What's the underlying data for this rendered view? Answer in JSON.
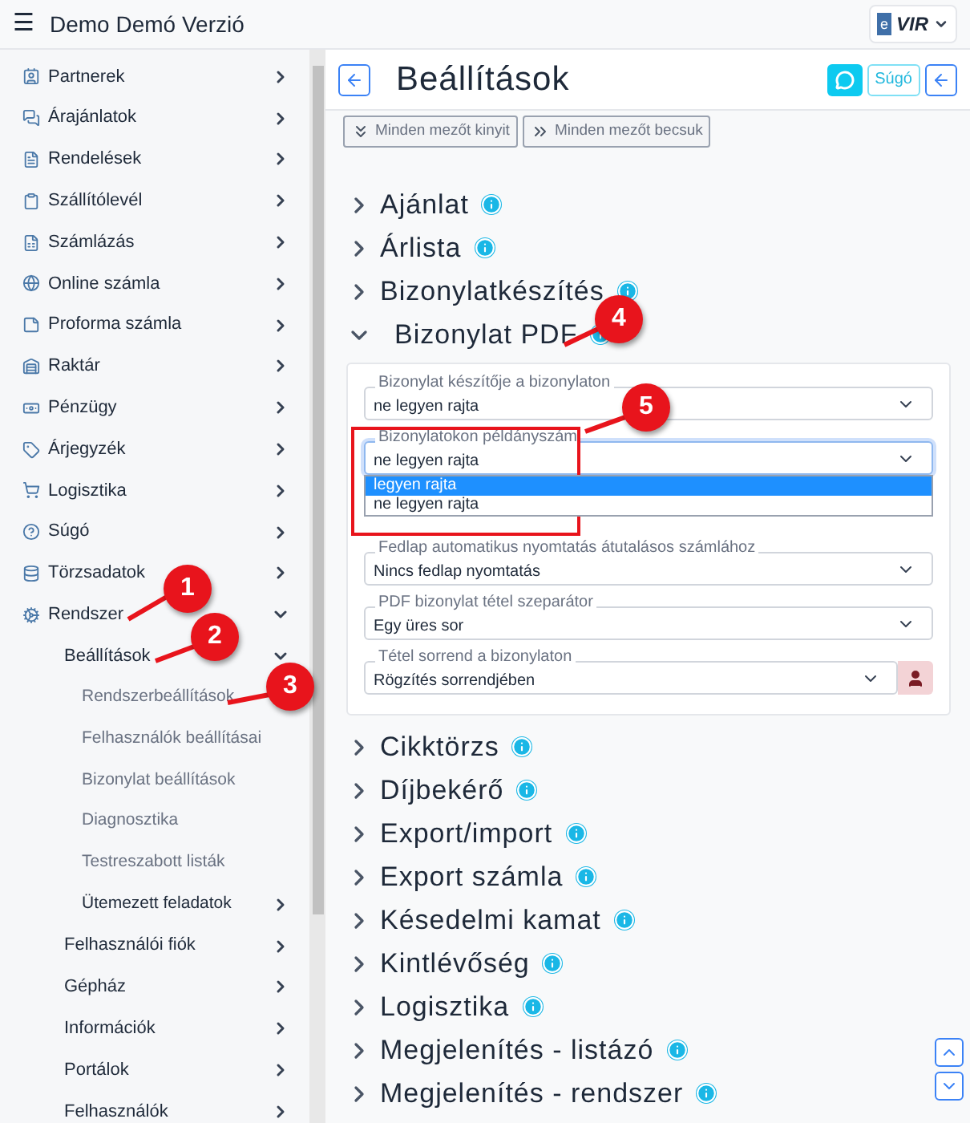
{
  "header": {
    "menu_glyph": "☰",
    "title": "Demo Demó Verzió",
    "logo": "e",
    "logo_text": "VIR"
  },
  "sidebar": {
    "items": [
      {
        "label": "Partnerek",
        "expanded": false
      },
      {
        "label": "Árajánlatok",
        "expanded": false
      },
      {
        "label": "Rendelések",
        "expanded": false
      },
      {
        "label": "Szállítólevél",
        "expanded": false
      },
      {
        "label": "Számlázás",
        "expanded": false
      },
      {
        "label": "Online számla",
        "expanded": false
      },
      {
        "label": "Proforma számla",
        "expanded": false
      },
      {
        "label": "Raktár",
        "expanded": false
      },
      {
        "label": "Pénzügy",
        "expanded": false
      },
      {
        "label": "Árjegyzék",
        "expanded": false
      },
      {
        "label": "Logisztika",
        "expanded": false
      },
      {
        "label": "Súgó",
        "expanded": false
      },
      {
        "label": "Törzsadatok",
        "expanded": false
      },
      {
        "label": "Rendszer",
        "expanded": true,
        "children": [
          {
            "label": "Beállítások",
            "expanded": true,
            "children": [
              {
                "label": "Rendszerbeállítások",
                "has_children": false
              },
              {
                "label": "Felhasználók beállításai",
                "has_children": false
              },
              {
                "label": "Bizonylat beállítások",
                "has_children": false
              },
              {
                "label": "Diagnosztika",
                "has_children": false
              },
              {
                "label": "Testreszabott listák",
                "has_children": false
              },
              {
                "label": "Ütemezett feladatok",
                "has_children": true
              }
            ]
          },
          {
            "label": "Felhasználói fiók",
            "expanded": false
          },
          {
            "label": "Gépház",
            "expanded": false
          },
          {
            "label": "Információk",
            "expanded": false
          },
          {
            "label": "Portálok",
            "expanded": false
          },
          {
            "label": "Felhasználók",
            "expanded": false
          }
        ]
      }
    ]
  },
  "page": {
    "title": "Beállítások",
    "help_button": "Súgó",
    "toolbar": [
      "Minden mezőt kinyit",
      "Minden mezőt becsuk"
    ]
  },
  "sections": [
    {
      "title": "Ajánlat",
      "expanded": false
    },
    {
      "title": "Árlista",
      "expanded": false
    },
    {
      "title": "Bizonylatkészítés",
      "expanded": false
    },
    {
      "title": "Bizonylat PDF",
      "expanded": true,
      "fields": [
        {
          "label": "Bizonylat készítője a bizonylaton",
          "value": "ne legyen rajta",
          "focused": false
        },
        {
          "label": "Bizonylatokon példányszám",
          "value": "ne legyen rajta",
          "focused": true,
          "options": [
            {
              "label": "legyen rajta",
              "highlighted": true
            },
            {
              "label": "ne legyen rajta",
              "highlighted": false
            }
          ]
        },
        {
          "kind": "hidden"
        },
        {
          "label": "Fedlap automatikus nyomtatás átutalásos számlához",
          "value": "Nincs fedlap nyomtatás",
          "focused": false
        },
        {
          "label": "PDF bizonylat tétel szeparátor",
          "value": "Egy üres sor",
          "focused": false
        },
        {
          "label": "Tétel sorrend a bizonylaton",
          "value": "Rögzítés sorrendjében",
          "focused": false,
          "user_button": true
        }
      ]
    },
    {
      "title": "Cikktörzs",
      "expanded": false
    },
    {
      "title": "Díjbekérő",
      "expanded": false
    },
    {
      "title": "Export/import",
      "expanded": false
    },
    {
      "title": "Export számla",
      "expanded": false
    },
    {
      "title": "Késedelmi kamat",
      "expanded": false
    },
    {
      "title": "Kintlévőség",
      "expanded": false
    },
    {
      "title": "Logisztika",
      "expanded": false
    },
    {
      "title": "Megjelenítés - listázó",
      "expanded": false
    },
    {
      "title": "Megjelenítés - rendszer",
      "expanded": false
    }
  ],
  "callouts": [
    "1",
    "2",
    "3",
    "4",
    "5"
  ]
}
